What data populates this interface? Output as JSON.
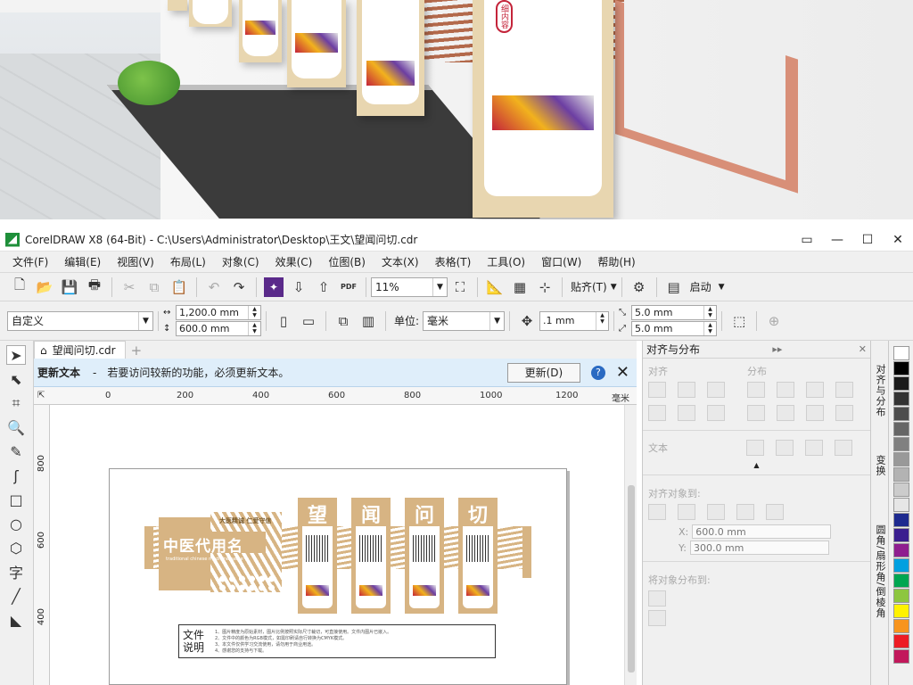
{
  "window": {
    "title": "CorelDRAW X8 (64-Bit) - C:\\Users\\Administrator\\Desktop\\王文\\望闻问切.cdr",
    "controls": [
      "▭",
      "—",
      "☐",
      "✕"
    ]
  },
  "preview": {
    "panel_labels": [
      "细内容"
    ]
  },
  "menu": [
    "文件(F)",
    "编辑(E)",
    "视图(V)",
    "布局(L)",
    "对象(C)",
    "效果(C)",
    "位图(B)",
    "文本(X)",
    "表格(T)",
    "工具(O)",
    "窗口(W)",
    "帮助(H)"
  ],
  "toolbar1": {
    "zoom": "11%",
    "pdf_label": "PDF",
    "snap_label": "贴齐(T)",
    "launch_label": "启动"
  },
  "toolbar2": {
    "paper_preset": "自定义",
    "width": "1,200.0 mm",
    "height": "600.0 mm",
    "unit_label": "单位:",
    "unit_value": "毫米",
    "nudge": ".1 mm",
    "dup_x": "5.0 mm",
    "dup_y": "5.0 mm"
  },
  "doc_tab": "望闻问切.cdr",
  "infobar": {
    "title": "更新文本",
    "dash": "-",
    "message": "若要访问较新的功能，必须更新文本。",
    "button": "更新(D)",
    "help": "?"
  },
  "ruler": {
    "h_labels": [
      "0",
      "200",
      "400",
      "600",
      "800",
      "1000",
      "1200"
    ],
    "h_unit": "毫米",
    "v_labels": [
      "800",
      "600",
      "400"
    ]
  },
  "design": {
    "name_title": "中医代用名",
    "tagline": "大医精诚 仁爱守信",
    "subtitle": "traditional chinese medicine name",
    "chars": [
      "望",
      "闻",
      "问",
      "切"
    ],
    "legend_title": "文件说明",
    "legend_lines": [
      "1、图片精度为原始素材，图片比例按照实际尺寸裁切，可直接使用。文件内图片已嵌入。",
      "2、文件中的颜色为RGB模式，如需印刷请自行转换为CMYK模式。",
      "3、本文件仅供学习交流使用，请勿用于商业用途。",
      "4、感谢您的支持与下载。"
    ]
  },
  "dock": {
    "title": "对齐与分布",
    "align_label": "对齐",
    "distribute_label": "分布",
    "text_label": "文本",
    "align_to_label": "对齐对象到:",
    "x_label": "X:",
    "x_value": "600.0 mm",
    "y_label": "Y:",
    "y_value": "300.0 mm",
    "distribute_to_label": "将对象分布到:"
  },
  "vertical_tabs": [
    "对齐与分布",
    "变换",
    "圆角/扇形角/倒棱角"
  ],
  "palette_colors": [
    "#ffffff",
    "#000000",
    "#1a1a1a",
    "#333333",
    "#4d4d4d",
    "#666666",
    "#808080",
    "#999999",
    "#b3b3b3",
    "#cccccc",
    "#e6e6e6",
    "#1e2a8f",
    "#3a1e8f",
    "#8f1e8f",
    "#00a0e0",
    "#00a651",
    "#8dc63f",
    "#fff200",
    "#f7941d",
    "#ed1c24",
    "#c2185b"
  ]
}
